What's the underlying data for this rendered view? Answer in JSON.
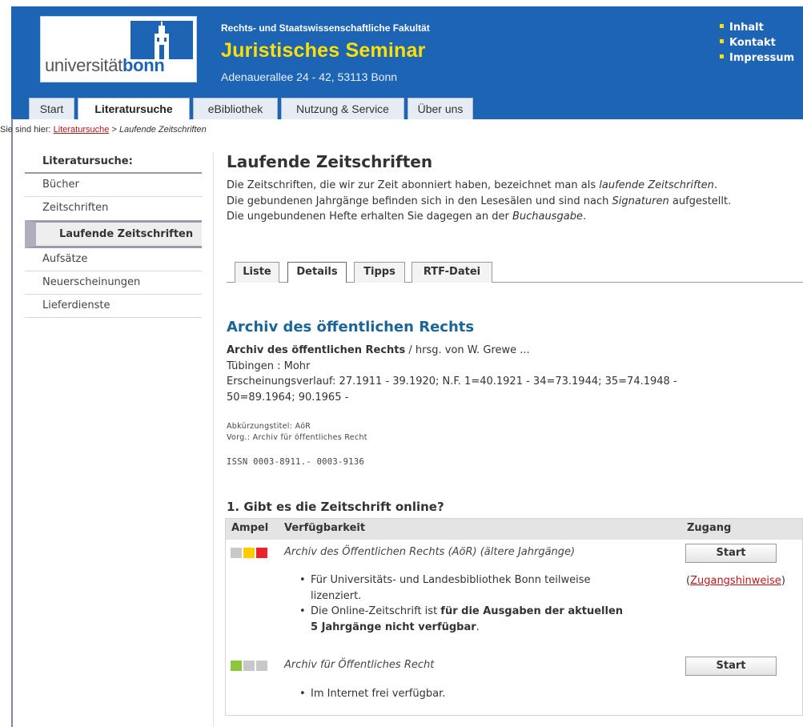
{
  "header": {
    "logo": {
      "prefix": "universität",
      "suffix": "bonn"
    },
    "faculty": "Rechts- und Staatswissenschaftliche Fakultät",
    "title": "Juristisches Seminar",
    "address": "Adenauerallee 24 - 42, 53113 Bonn",
    "util_links": [
      "Inhalt",
      "Kontakt",
      "Impressum"
    ],
    "colors": {
      "brand_blue": "#1e64b4",
      "title_yellow": "#ffe000"
    }
  },
  "tabs": [
    {
      "label": "Start",
      "active": false
    },
    {
      "label": "Literatursuche",
      "active": true
    },
    {
      "label": "eBibliothek",
      "active": false
    },
    {
      "label": "Nutzung & Service",
      "active": false
    },
    {
      "label": "Über uns",
      "active": false
    }
  ],
  "breadcrumb": {
    "prefix": "Sie sind hier:",
    "link": "Literatursuche",
    "separator": ">",
    "current": "Laufende Zeitschriften"
  },
  "sidebar": {
    "heading": "Literatursuche:",
    "items": [
      "Bücher",
      "Zeitschriften"
    ],
    "active_sub": "Laufende Zeitschriften",
    "items_after": [
      "Aufsätze",
      "Neuerscheinungen",
      "Lieferdienste"
    ]
  },
  "main": {
    "title": "Laufende Zeitschriften",
    "intro": {
      "l1_a": "Die Zeitschriften, die wir zur Zeit abonniert haben, bezeichnet man als ",
      "l1_em": "laufende Zeitschriften",
      "l1_b": ".",
      "l2_a": "Die gebundenen Jahrgänge befinden sich in den Lesesälen und sind nach ",
      "l2_em": "Signaturen",
      "l2_b": " aufgestellt.",
      "l3_a": "Die ungebundenen Hefte erhalten Sie dagegen an der ",
      "l3_em": "Buchausgabe",
      "l3_b": "."
    },
    "detail_tabs": [
      {
        "label": "Liste",
        "active": false
      },
      {
        "label": "Details",
        "active": true
      },
      {
        "label": "Tipps",
        "active": false
      },
      {
        "label": "RTF-Datei",
        "active": false
      }
    ],
    "journal": {
      "heading": "Archiv des öffentlichen Rechts",
      "title_bold": "Archiv des öffentlichen Rechts",
      "title_rest": " / hrsg. von W. Grewe ...",
      "publisher": "Tübingen : Mohr",
      "history_1": "Erscheinungsverlauf: 27.1911 - 39.1920; N.F. 1=40.1921 - 34=73.1944; 35=74.1948 -",
      "history_2": "50=89.1964; 90.1965 -",
      "abbrev": "Abkürzungstitel: AöR",
      "previous": "Vorg.: Archiv für öffentliches Recht",
      "issn": "ISSN 0003-8911.- 0003-9136"
    },
    "online": {
      "heading": "1. Gibt es die Zeitschrift online?",
      "columns": {
        "light": "Ampel",
        "availability": "Verfügbarkeit",
        "access": "Zugang"
      },
      "rows": [
        {
          "lights": [
            "#c8c8c8",
            "#ffcc00",
            "#e8232a"
          ],
          "title": "Archiv des Öffentlichen Rechts (AöR) (ältere Jahrgänge)",
          "button": "Start",
          "bullet_1": "Für Universitäts- und Landesbibliothek Bonn teilweise",
          "bullet_1b": "lizenziert.",
          "bullet_2_a": "Die Online-Zeitschrift ist ",
          "bullet_2_bold_1": "für die Ausgaben der aktuellen",
          "bullet_2_bold_2": "5 Jahrgänge nicht verfügbar",
          "bullet_2_end": ".",
          "hint_open": "(",
          "hint_link": "Zugangshinweise",
          "hint_close": ")"
        },
        {
          "lights": [
            "#8cc63f",
            "#c8c8c8",
            "#c8c8c8"
          ],
          "title": "Archiv für Öffentliches Recht",
          "button": "Start",
          "bullet_1": "Im Internet frei verfügbar."
        }
      ]
    }
  }
}
